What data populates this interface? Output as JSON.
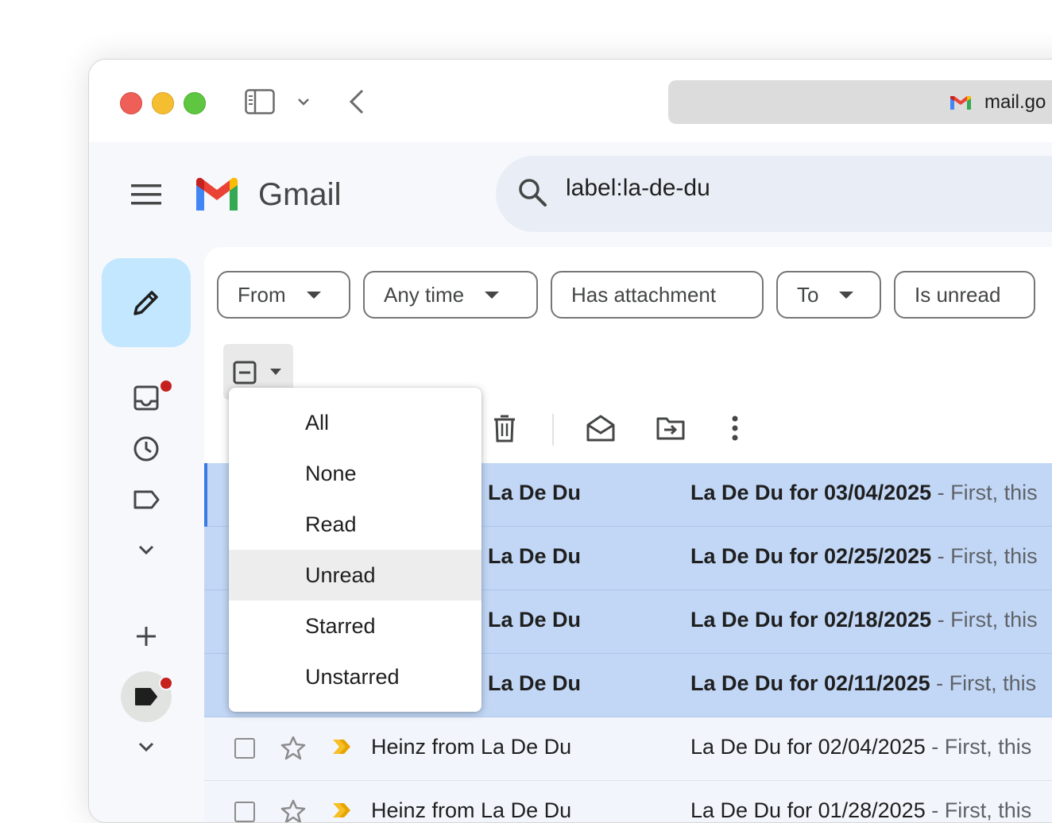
{
  "browser": {
    "address": "mail.go"
  },
  "app": {
    "name": "Gmail"
  },
  "search": {
    "query": "label:la-de-du"
  },
  "filters": [
    {
      "label": "From",
      "has_caret": true
    },
    {
      "label": "Any time",
      "has_caret": true
    },
    {
      "label": "Has attachment",
      "has_caret": false
    },
    {
      "label": "To",
      "has_caret": true
    },
    {
      "label": "Is unread",
      "has_caret": false
    }
  ],
  "select_menu": {
    "items": [
      "All",
      "None",
      "Read",
      "Unread",
      "Starred",
      "Unstarred"
    ],
    "highlighted": "Unread"
  },
  "emails": [
    {
      "sender": "Heinz from La De Du",
      "subject": "La De Du for 03/04/2025",
      "snippet": " - First, this",
      "selected": true,
      "unread": true
    },
    {
      "sender": "Heinz from La De Du",
      "subject": "La De Du for 02/25/2025",
      "snippet": " - First, this",
      "selected": true,
      "unread": true
    },
    {
      "sender": "Heinz from La De Du",
      "subject": "La De Du for 02/18/2025",
      "snippet": " - First, this",
      "selected": true,
      "unread": true
    },
    {
      "sender": "Heinz from La De Du",
      "subject": "La De Du for 02/11/2025",
      "snippet": " - First, this",
      "selected": true,
      "unread": true
    },
    {
      "sender": "Heinz from La De Du",
      "subject": "La De Du for 02/04/2025",
      "snippet": " - First, this",
      "selected": false,
      "unread": false
    },
    {
      "sender": "Heinz from La De Du",
      "subject": "La De Du for 01/28/2025",
      "snippet": " - First, this",
      "selected": false,
      "unread": false
    }
  ],
  "colors": {
    "selected_row": "#c2d7f6",
    "compose_bg": "#c2e7ff",
    "badge": "#c5221f"
  }
}
